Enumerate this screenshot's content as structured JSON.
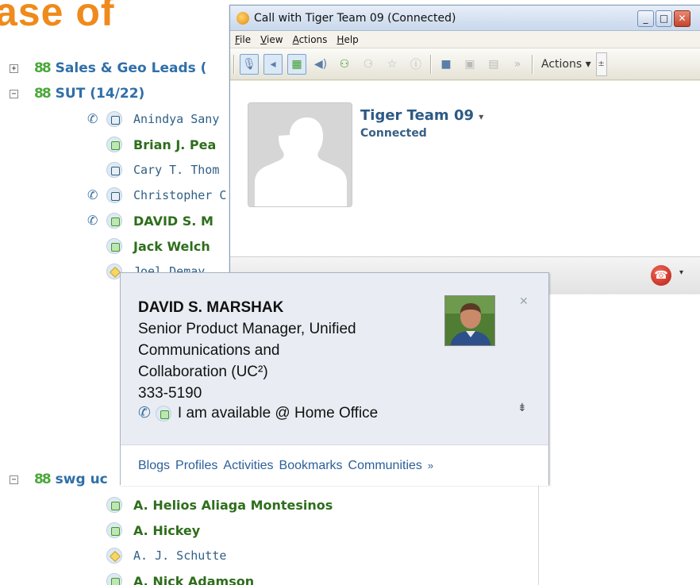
{
  "slide": {
    "title_fragment": "ase of"
  },
  "contact_list": {
    "groups": [
      {
        "label": "Sales & Geo Leads (",
        "expander": "+"
      },
      {
        "label": "SUT (14/22)",
        "expander": "−"
      },
      {
        "label": "swg uc",
        "expander": "−"
      }
    ],
    "sut_members": [
      {
        "name": "Anindya Sany",
        "style": "plain",
        "status": "offline",
        "phone": true
      },
      {
        "name": "Brian J. Pea",
        "style": "bold",
        "status": "available",
        "phone": false
      },
      {
        "name": "Cary T. Thom",
        "style": "plain",
        "status": "offline",
        "phone": false
      },
      {
        "name": "Christopher C",
        "style": "plain",
        "status": "offline",
        "phone": true
      },
      {
        "name": "DAVID S. M",
        "style": "bold",
        "status": "available",
        "phone": true
      },
      {
        "name": "Jack Welch",
        "style": "bold",
        "status": "available",
        "phone": false
      },
      {
        "name": "Joel Demay",
        "style": "plain",
        "status": "away",
        "phone": false
      }
    ],
    "swg_members": [
      {
        "name": "A. Helios Aliaga Montesinos",
        "style": "bold",
        "status": "available"
      },
      {
        "name": "A. Hickey",
        "style": "bold",
        "status": "available"
      },
      {
        "name": "A. J. Schutte",
        "style": "plain",
        "status": "away"
      },
      {
        "name": "A. Nick Adamson",
        "style": "bold",
        "status": "available"
      }
    ]
  },
  "call_window": {
    "title": "Call with Tiger Team 09 (Connected)",
    "window_buttons": {
      "minimize": "_",
      "maximize": "□",
      "close": "✕"
    },
    "menu": [
      "File",
      "View",
      "Actions",
      "Help"
    ],
    "toolbar_actions_label": "Actions",
    "contact_name": "Tiger Team 09",
    "contact_status": "Connected"
  },
  "business_card": {
    "name": "DAVID S. MARSHAK",
    "title_line1": "Senior Product Manager, Unified",
    "title_line2": "Communications and",
    "title_line3": "Collaboration (UC²)",
    "phone": "333-5190",
    "availability": "I am available @ Home Office",
    "links": [
      "Blogs",
      "Profiles",
      "Activities",
      "Bookmarks",
      "Communities"
    ],
    "more": "»"
  }
}
